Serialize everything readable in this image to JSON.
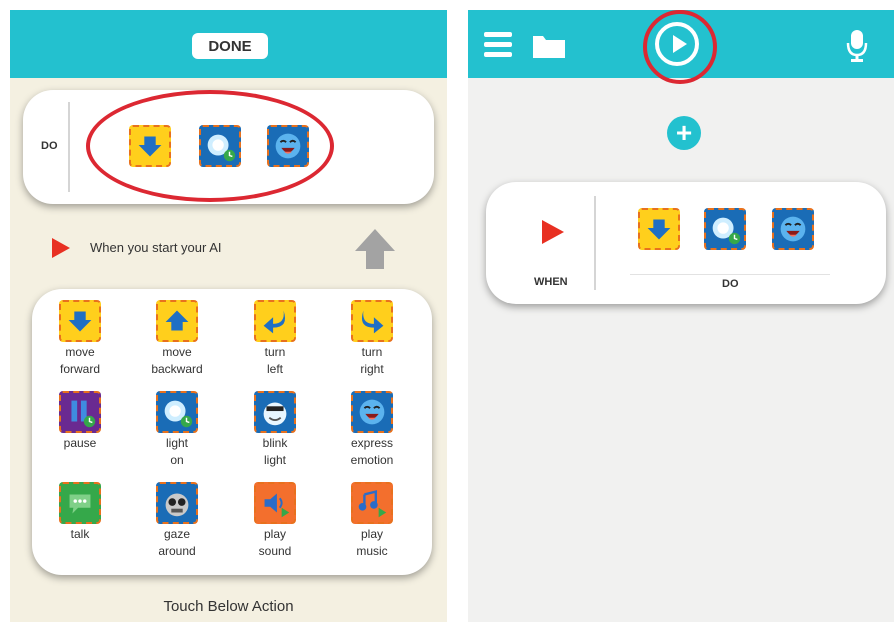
{
  "left_screen": {
    "top_bar": {
      "done_label": "DONE"
    },
    "sequence_card": {
      "do_label": "DO",
      "selected_blocks": [
        "move-forward-icon",
        "light-on-icon",
        "express-emotion-icon"
      ]
    },
    "trigger": {
      "text": "When you start your AI"
    },
    "action_palette": [
      {
        "icon": "move-forward-icon",
        "line1": "move",
        "line2": "forward"
      },
      {
        "icon": "move-backward-icon",
        "line1": "move",
        "line2": "backward"
      },
      {
        "icon": "turn-left-icon",
        "line1": "turn",
        "line2": "left"
      },
      {
        "icon": "turn-right-icon",
        "line1": "turn",
        "line2": "right"
      },
      {
        "icon": "pause-icon",
        "line1": "pause",
        "line2": ""
      },
      {
        "icon": "light-on-icon",
        "line1": "light",
        "line2": "on"
      },
      {
        "icon": "blink-light-icon",
        "line1": "blink",
        "line2": "light"
      },
      {
        "icon": "express-emotion-icon",
        "line1": "express",
        "line2": "emotion"
      },
      {
        "icon": "talk-icon",
        "line1": "talk",
        "line2": ""
      },
      {
        "icon": "gaze-around-icon",
        "line1": "gaze",
        "line2": "around"
      },
      {
        "icon": "play-sound-icon",
        "line1": "play",
        "line2": "sound"
      },
      {
        "icon": "play-music-icon",
        "line1": "play",
        "line2": "music"
      }
    ],
    "footer": {
      "text": "Touch Below Action"
    }
  },
  "right_screen": {
    "top_bar": {
      "icons": [
        "menu-icon",
        "folder-icon",
        "play-icon",
        "microphone-icon"
      ]
    },
    "add_label": "+",
    "rule_card": {
      "when_label": "WHEN",
      "do_label": "DO",
      "blocks": [
        "move-forward-icon",
        "light-on-icon",
        "express-emotion-icon"
      ]
    }
  },
  "colors": {
    "top_bar": "#23c1cf",
    "highlight": "#dc2832",
    "trigger_arrow": "#e83022",
    "tile_border": "#e8711d"
  }
}
